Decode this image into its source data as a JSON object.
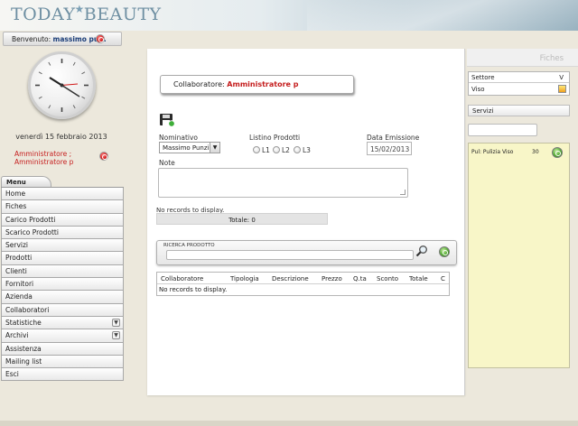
{
  "app": {
    "logo_left": "TODAY",
    "logo_right": "BEAUTY"
  },
  "user": {
    "welcome_prefix": "Benvenuto: ",
    "name": "massimo pu..."
  },
  "sidebar": {
    "date": "venerdì 15 febbraio 2013",
    "role_line1": "Amministratore ;",
    "role_line2": "Amministratore p",
    "menu_tab": "Menu",
    "menu": [
      "Home",
      "Fiches",
      "Carico Prodotti",
      "Scarico Prodotti",
      "Servizi",
      "Prodotti",
      "Clienti",
      "Fornitori",
      "Azienda",
      "Collaboratori",
      "Statistiche",
      "Archivi",
      "Assistenza",
      "Mailing list",
      "Esci"
    ],
    "expandable": [
      "Statistiche",
      "Archivi"
    ]
  },
  "form": {
    "collab_label": "Collaboratore: ",
    "collab_value": "Amministratore p",
    "nominativo_label": "Nominativo",
    "nominativo_value": "Massimo Punzino",
    "listino_label": "Listino Prodotti",
    "radios": [
      "L1",
      "L2",
      "L3"
    ],
    "data_label": "Data Emissione",
    "data_value": "15/02/2013",
    "note_label": "Note",
    "no_records": "No records to display.",
    "totale": "Totale: 0",
    "ricerca_label": "RICERCA PRODOTTO"
  },
  "grid": {
    "columns": [
      "Collaboratore",
      "Tipologia",
      "Descrizione",
      "Prezzo",
      "Q.ta",
      "Sconto",
      "Totale",
      "C"
    ],
    "empty_text": "No records to display."
  },
  "right": {
    "tab": "Fiches",
    "settore_header": "Settore",
    "settore_v": "V",
    "settore_value": "Viso",
    "servizi_label": "Servizi",
    "service_item": "Pul: Pulizia Viso",
    "service_qty": "30"
  }
}
